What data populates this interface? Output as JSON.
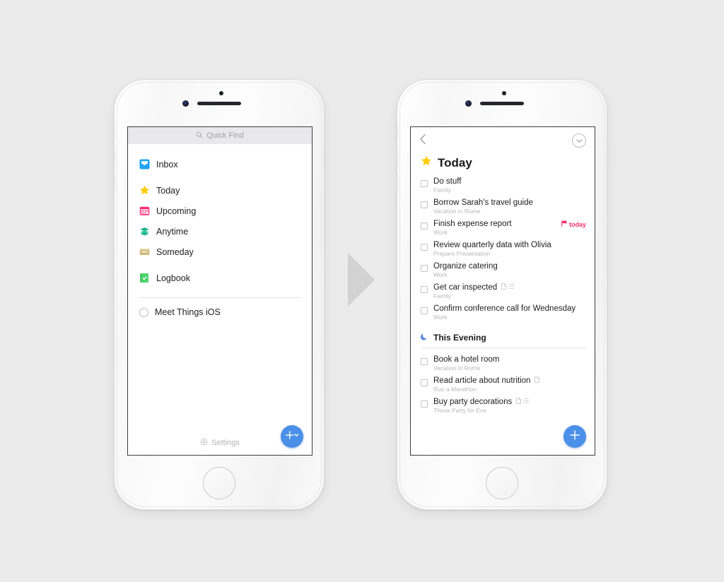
{
  "left_phone": {
    "search": {
      "placeholder": "Quick Find",
      "icon": "search-icon"
    },
    "nav_items": [
      {
        "label": "Inbox",
        "icon": "inbox-icon",
        "color": "#1fa3f0"
      },
      {
        "label": "Today",
        "icon": "star-icon",
        "color": "#ffcc00"
      },
      {
        "label": "Upcoming",
        "icon": "calendar-icon",
        "color": "#ff2e74"
      },
      {
        "label": "Anytime",
        "icon": "layers-icon",
        "color": "#1db68f"
      },
      {
        "label": "Someday",
        "icon": "box-icon",
        "color": "#cfb877"
      },
      {
        "label": "Logbook",
        "icon": "book-check-icon",
        "color": "#3dc357"
      }
    ],
    "project": {
      "label": "Meet Things iOS",
      "icon": "circle-checkbox-icon"
    },
    "settings": {
      "label": "Settings",
      "icon": "gear-icon"
    },
    "fab": {
      "label": "+",
      "icon": "plus-chevron-icon",
      "color": "#4a90e8"
    }
  },
  "right_phone": {
    "topnav": {
      "back_icon": "chevron-left-icon",
      "menu_icon": "chevron-down-circle-icon"
    },
    "title": {
      "label": "Today",
      "icon": "star-icon",
      "color": "#ffcc00"
    },
    "tasks": [
      {
        "title": "Do stuff",
        "sub": "Family",
        "badge": "",
        "attachments": []
      },
      {
        "title": "Borrow Sarah's travel guide",
        "sub": "Vacation in Rome",
        "badge": "",
        "attachments": []
      },
      {
        "title": "Finish expense report",
        "sub": "Work",
        "badge": "today",
        "attachments": []
      },
      {
        "title": "Review quarterly data with Olivia",
        "sub": "Prepare Presentation",
        "badge": "",
        "attachments": []
      },
      {
        "title": "Organize catering",
        "sub": "Work",
        "badge": "",
        "attachments": []
      },
      {
        "title": "Get car inspected",
        "sub": "Family",
        "badge": "",
        "attachments": [
          "note-icon",
          "checklist-icon"
        ]
      },
      {
        "title": "Confirm conference call for Wednesday",
        "sub": "Work",
        "badge": "",
        "attachments": []
      }
    ],
    "evening": {
      "label": "This Evening",
      "icon": "moon-icon",
      "color": "#5b8ce0",
      "tasks": [
        {
          "title": "Book a hotel room",
          "sub": "Vacation in Rome",
          "attachments": []
        },
        {
          "title": "Read article about nutrition",
          "sub": "Run a Marathon",
          "attachments": [
            "note-icon"
          ]
        },
        {
          "title": "Buy party decorations",
          "sub": "Throw Party for Eve",
          "attachments": [
            "note-icon",
            "checklist-icon"
          ]
        }
      ]
    },
    "badge_flag_color": "#f5326a",
    "fab": {
      "label": "+",
      "icon": "plus-icon",
      "color": "#4a90e8"
    }
  },
  "arrow": {
    "icon": "triangle-right-icon",
    "color": "#d2d2d2"
  },
  "background_color": "#ebebeb"
}
